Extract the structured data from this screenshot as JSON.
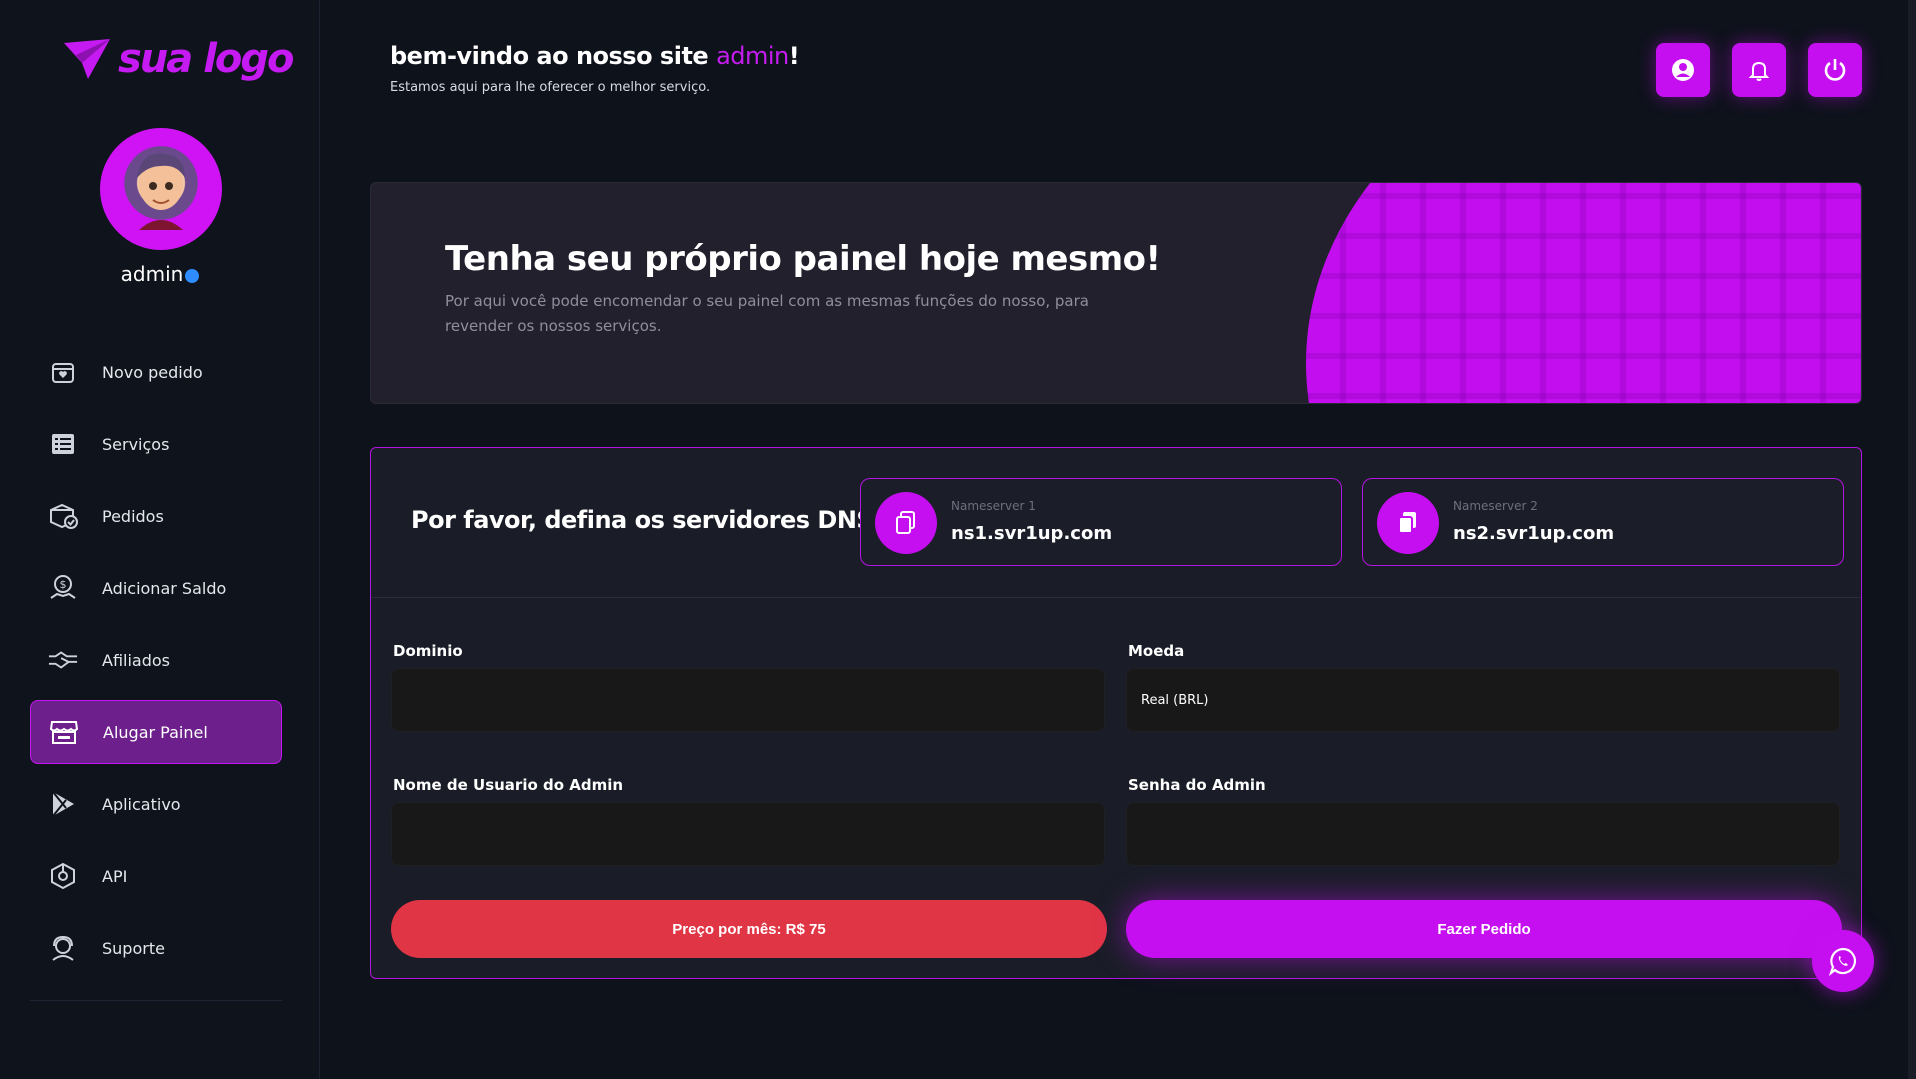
{
  "brand": {
    "logo_text": "sua logo",
    "accent": "#c50ff0",
    "danger": "#e03545"
  },
  "user": {
    "name": "admin"
  },
  "sidebar": {
    "items": [
      {
        "label": "Novo pedido",
        "icon": "calendar-heart-icon"
      },
      {
        "label": "Serviços",
        "icon": "list-icon"
      },
      {
        "label": "Pedidos",
        "icon": "box-check-icon"
      },
      {
        "label": "Adicionar Saldo",
        "icon": "money-hand-icon"
      },
      {
        "label": "Afiliados",
        "icon": "handshake-icon"
      },
      {
        "label": "Alugar Painel",
        "icon": "store-icon",
        "active": true
      },
      {
        "label": "Aplicativo",
        "icon": "play-store-icon"
      },
      {
        "label": "API",
        "icon": "api-icon"
      },
      {
        "label": "Suporte",
        "icon": "support-icon"
      }
    ]
  },
  "header": {
    "greeting_prefix": "bem-vindo ao nosso site ",
    "greeting_user": "admin",
    "greeting_suffix": "!",
    "subtitle": "Estamos aqui para lhe oferecer o melhor serviço."
  },
  "banner": {
    "title": "Tenha seu próprio painel hoje mesmo!",
    "text": "Por aqui você pode encomendar o seu painel com as mesmas funções do nosso, para revender os nossos serviços."
  },
  "dns": {
    "title": "Por favor, defina os servidores DNS:",
    "ns1_label": "Nameserver 1",
    "ns1_value": "ns1.svr1up.com",
    "ns2_label": "Nameserver 2",
    "ns2_value": "ns2.svr1up.com"
  },
  "form": {
    "domain_label": "Dominio",
    "domain_value": "",
    "currency_label": "Moeda",
    "currency_value": "Real (BRL)",
    "admin_user_label": "Nome de Usuario do Admin",
    "admin_user_value": "",
    "admin_pass_label": "Senha do Admin",
    "admin_pass_value": "",
    "price_button": "Preço por mês: R$ 75",
    "submit_button": "Fazer Pedido"
  }
}
